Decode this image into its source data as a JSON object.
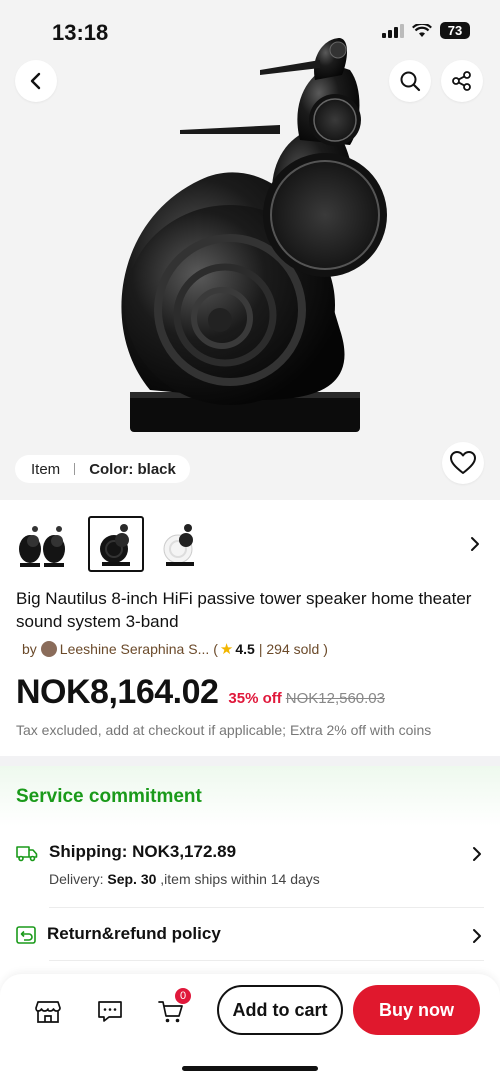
{
  "status_bar": {
    "time": "13:18",
    "battery": "73"
  },
  "hero": {
    "item_label": "Item",
    "color_label": "Color: black"
  },
  "icons": {
    "back": "chevron-left-icon",
    "search": "search-icon",
    "share": "share-icon",
    "wishlist": "heart-icon",
    "thumb_more": "chevron-right-icon",
    "shipping": "truck-icon",
    "return": "return-icon",
    "store": "store-icon",
    "chat": "chat-icon",
    "cart": "cart-icon"
  },
  "product": {
    "title": "Big Nautilus 8-inch HiFi passive tower speaker home theater sound system 3-band",
    "by": "by",
    "seller": "Leeshine Seraphina S...",
    "open_paren": "(",
    "rating": "4.5",
    "sold": "| 294 sold )",
    "price": "NOK8,164.02",
    "discount": "35% off",
    "original_price": "NOK12,560.03",
    "tax_note": "Tax excluded, add at checkout if applicable; Extra 2% off with coins"
  },
  "service": {
    "title": "Service commitment",
    "shipping_title": "Shipping: NOK3,172.89",
    "delivery_label": "Delivery:",
    "delivery_date": "Sep. 30",
    "delivery_rest": ",item ships within 14 days",
    "return_title": "Return&refund policy"
  },
  "bottom_bar": {
    "cart_count": "0",
    "add_to_cart": "Add to cart",
    "buy_now": "Buy now"
  },
  "colors": {
    "accent_red": "#e0182d",
    "service_green": "#1a9a1a",
    "star": "#f2b600"
  }
}
